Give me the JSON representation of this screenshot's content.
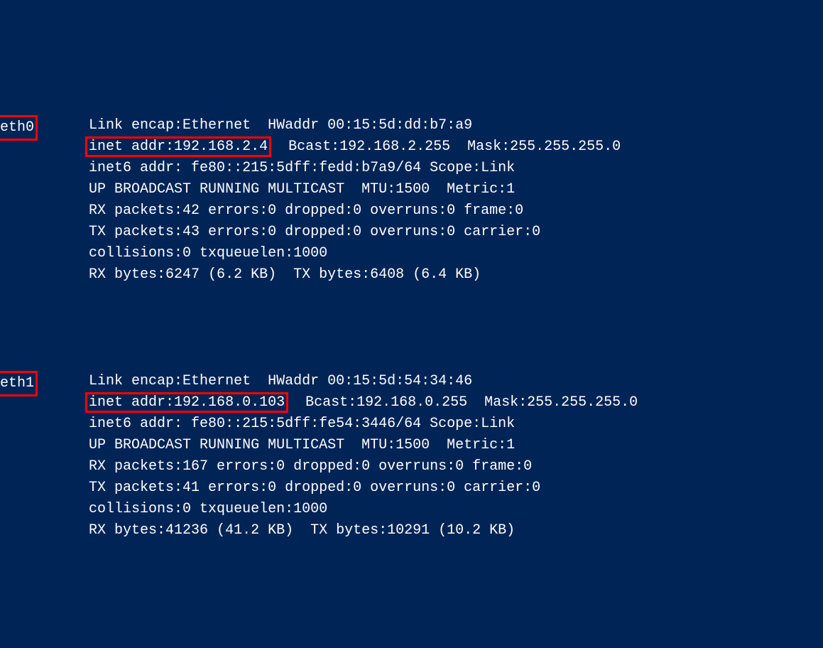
{
  "interfaces": [
    {
      "name": "eth0",
      "link_line": "Link encap:Ethernet  HWaddr 00:15:5d:dd:b7:a9",
      "inet_highlight": "inet addr:192.168.2.4",
      "inet_rest": "  Bcast:192.168.2.255  Mask:255.255.255.0",
      "inet6": "inet6 addr: fe80::215:5dff:fedd:b7a9/64 Scope:Link",
      "flags": "UP BROADCAST RUNNING MULTICAST  MTU:1500  Metric:1",
      "rx_packets": "RX packets:42 errors:0 dropped:0 overruns:0 frame:0",
      "tx_packets": "TX packets:43 errors:0 dropped:0 overruns:0 carrier:0",
      "collisions": "collisions:0 txqueuelen:1000",
      "bytes": "RX bytes:6247 (6.2 KB)  TX bytes:6408 (6.4 KB)"
    },
    {
      "name": "eth1",
      "link_line": "Link encap:Ethernet  HWaddr 00:15:5d:54:34:46",
      "inet_highlight": "inet addr:192.168.0.103",
      "inet_rest": "  Bcast:192.168.0.255  Mask:255.255.255.0",
      "inet6": "inet6 addr: fe80::215:5dff:fe54:3446/64 Scope:Link",
      "flags": "UP BROADCAST RUNNING MULTICAST  MTU:1500  Metric:1",
      "rx_packets": "RX packets:167 errors:0 dropped:0 overruns:0 frame:0",
      "tx_packets": "TX packets:41 errors:0 dropped:0 overruns:0 carrier:0",
      "collisions": "collisions:0 txqueuelen:1000",
      "bytes": "RX bytes:41236 (41.2 KB)  TX bytes:10291 (10.2 KB)"
    }
  ]
}
